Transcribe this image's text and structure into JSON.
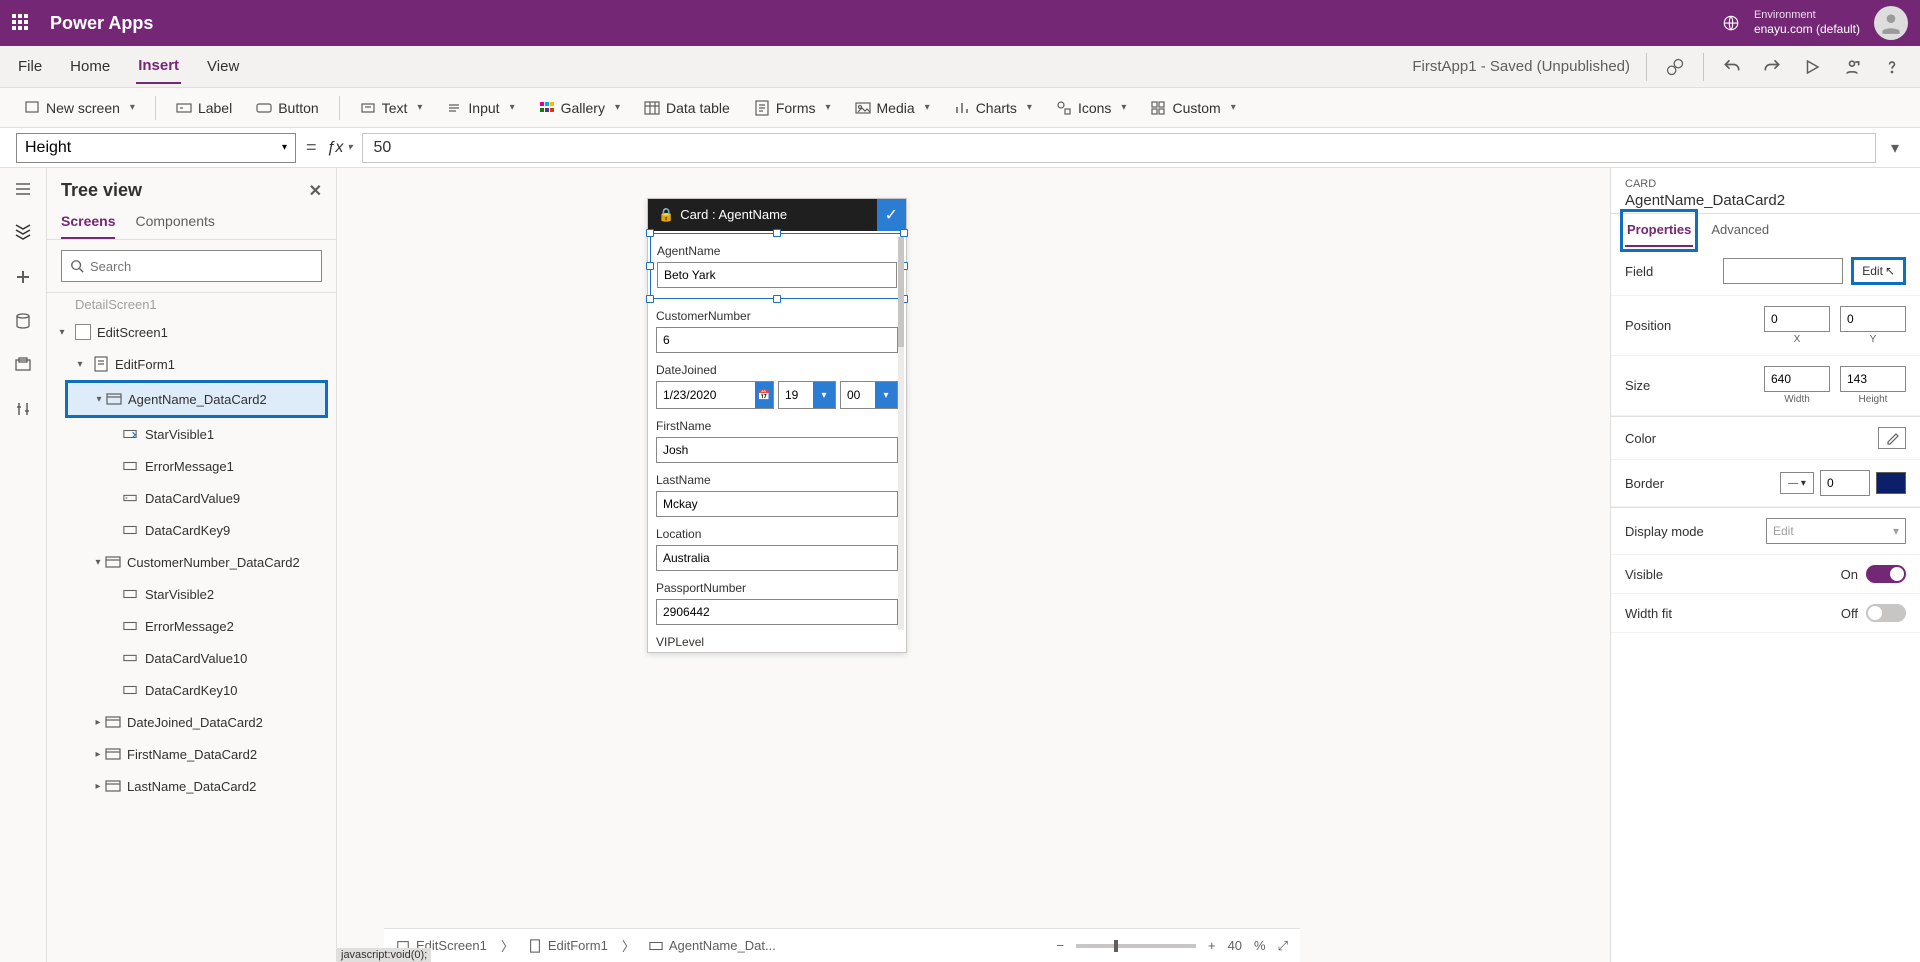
{
  "header": {
    "app": "Power Apps",
    "env_label": "Environment",
    "env_value": "enayu.com (default)"
  },
  "menu": {
    "items": [
      "File",
      "Home",
      "Insert",
      "View"
    ],
    "active": "Insert",
    "docstate": "FirstApp1 - Saved (Unpublished)"
  },
  "ribbon": {
    "newscreen": "New screen",
    "label": "Label",
    "button": "Button",
    "text": "Text",
    "input": "Input",
    "gallery": "Gallery",
    "datatable": "Data table",
    "forms": "Forms",
    "media": "Media",
    "charts": "Charts",
    "icons": "Icons",
    "custom": "Custom"
  },
  "formula": {
    "property": "Height",
    "value": "50"
  },
  "tree": {
    "title": "Tree view",
    "tab_screens": "Screens",
    "tab_components": "Components",
    "search_ph": "Search",
    "cut_node": "DetailScreen1",
    "nodes": {
      "editscreen": "EditScreen1",
      "editform": "EditForm1",
      "agentcard": "AgentName_DataCard2",
      "starvis1": "StarVisible1",
      "errmsg1": "ErrorMessage1",
      "dcv9": "DataCardValue9",
      "dck9": "DataCardKey9",
      "custcard": "CustomerNumber_DataCard2",
      "starvis2": "StarVisible2",
      "errmsg2": "ErrorMessage2",
      "dcv10": "DataCardValue10",
      "dck10": "DataCardKey10",
      "datejoin": "DateJoined_DataCard2",
      "firstname": "FirstName_DataCard2",
      "lastname": "LastName_DataCard2"
    }
  },
  "canvas": {
    "card_title": "Card : AgentName",
    "fields": {
      "agent_label": "AgentName",
      "agent_val": "Beto Yark",
      "cust_label": "CustomerNumber",
      "cust_val": "6",
      "date_label": "DateJoined",
      "date_val": "1/23/2020",
      "date_hh": "19",
      "date_mm": "00",
      "first_label": "FirstName",
      "first_val": "Josh",
      "last_label": "LastName",
      "last_val": "Mckay",
      "loc_label": "Location",
      "loc_val": "Australia",
      "pass_label": "PassportNumber",
      "pass_val": "2906442",
      "vip_label": "VIPLevel"
    }
  },
  "props": {
    "type": "CARD",
    "name": "AgentName_DataCard2",
    "tab_properties": "Properties",
    "tab_advanced": "Advanced",
    "rows": {
      "field": "Field",
      "field_edit": "Edit",
      "position": "Position",
      "x": "0",
      "y": "0",
      "xl": "X",
      "yl": "Y",
      "size": "Size",
      "w": "640",
      "h": "143",
      "wl": "Width",
      "hl": "Height",
      "color": "Color",
      "border": "Border",
      "border_val": "0",
      "display_mode": "Display mode",
      "dm_val": "Edit",
      "visible": "Visible",
      "visible_state": "On",
      "widthfit": "Width fit",
      "widthfit_state": "Off"
    }
  },
  "breadcrumb": {
    "s1": "EditScreen1",
    "s2": "EditForm1",
    "s3": "AgentName_Dat..."
  },
  "zoom": {
    "value": "40",
    "unit": "%"
  },
  "status": "javascript:void(0);"
}
